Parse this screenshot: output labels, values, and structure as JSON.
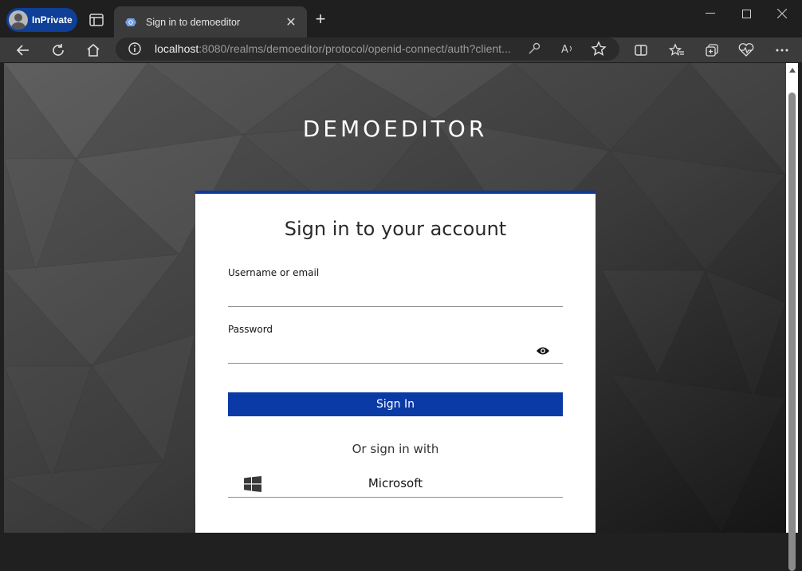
{
  "browser": {
    "inprivate_label": "InPrivate",
    "tab_title": "Sign in to demoeditor",
    "url_host": "localhost",
    "url_rest": ":8080/realms/demoeditor/protocol/openid-connect/auth?client...",
    "accent": "#0f3f96"
  },
  "page": {
    "realm_name": "DEMOEDITOR",
    "heading": "Sign in to your account",
    "username_label": "Username or email",
    "username_value": "",
    "password_label": "Password",
    "password_value": "",
    "signin_label": "Sign In",
    "alt_signin_label": "Or sign in with",
    "provider_label": "Microsoft",
    "primary_color": "#0a3aa6"
  }
}
